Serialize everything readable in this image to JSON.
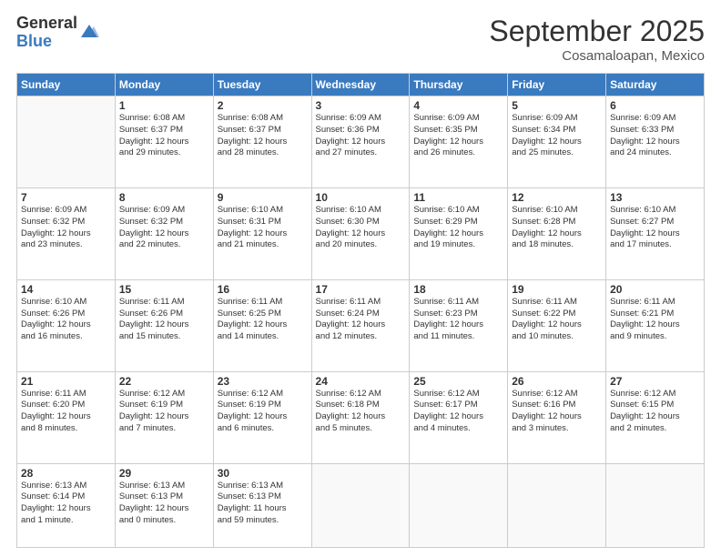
{
  "logo": {
    "general": "General",
    "blue": "Blue"
  },
  "title": "September 2025",
  "location": "Cosamaloapan, Mexico",
  "weekdays": [
    "Sunday",
    "Monday",
    "Tuesday",
    "Wednesday",
    "Thursday",
    "Friday",
    "Saturday"
  ],
  "weeks": [
    [
      {
        "day": "",
        "info": ""
      },
      {
        "day": "1",
        "info": "Sunrise: 6:08 AM\nSunset: 6:37 PM\nDaylight: 12 hours\nand 29 minutes."
      },
      {
        "day": "2",
        "info": "Sunrise: 6:08 AM\nSunset: 6:37 PM\nDaylight: 12 hours\nand 28 minutes."
      },
      {
        "day": "3",
        "info": "Sunrise: 6:09 AM\nSunset: 6:36 PM\nDaylight: 12 hours\nand 27 minutes."
      },
      {
        "day": "4",
        "info": "Sunrise: 6:09 AM\nSunset: 6:35 PM\nDaylight: 12 hours\nand 26 minutes."
      },
      {
        "day": "5",
        "info": "Sunrise: 6:09 AM\nSunset: 6:34 PM\nDaylight: 12 hours\nand 25 minutes."
      },
      {
        "day": "6",
        "info": "Sunrise: 6:09 AM\nSunset: 6:33 PM\nDaylight: 12 hours\nand 24 minutes."
      }
    ],
    [
      {
        "day": "7",
        "info": "Sunrise: 6:09 AM\nSunset: 6:32 PM\nDaylight: 12 hours\nand 23 minutes."
      },
      {
        "day": "8",
        "info": "Sunrise: 6:09 AM\nSunset: 6:32 PM\nDaylight: 12 hours\nand 22 minutes."
      },
      {
        "day": "9",
        "info": "Sunrise: 6:10 AM\nSunset: 6:31 PM\nDaylight: 12 hours\nand 21 minutes."
      },
      {
        "day": "10",
        "info": "Sunrise: 6:10 AM\nSunset: 6:30 PM\nDaylight: 12 hours\nand 20 minutes."
      },
      {
        "day": "11",
        "info": "Sunrise: 6:10 AM\nSunset: 6:29 PM\nDaylight: 12 hours\nand 19 minutes."
      },
      {
        "day": "12",
        "info": "Sunrise: 6:10 AM\nSunset: 6:28 PM\nDaylight: 12 hours\nand 18 minutes."
      },
      {
        "day": "13",
        "info": "Sunrise: 6:10 AM\nSunset: 6:27 PM\nDaylight: 12 hours\nand 17 minutes."
      }
    ],
    [
      {
        "day": "14",
        "info": "Sunrise: 6:10 AM\nSunset: 6:26 PM\nDaylight: 12 hours\nand 16 minutes."
      },
      {
        "day": "15",
        "info": "Sunrise: 6:11 AM\nSunset: 6:26 PM\nDaylight: 12 hours\nand 15 minutes."
      },
      {
        "day": "16",
        "info": "Sunrise: 6:11 AM\nSunset: 6:25 PM\nDaylight: 12 hours\nand 14 minutes."
      },
      {
        "day": "17",
        "info": "Sunrise: 6:11 AM\nSunset: 6:24 PM\nDaylight: 12 hours\nand 12 minutes."
      },
      {
        "day": "18",
        "info": "Sunrise: 6:11 AM\nSunset: 6:23 PM\nDaylight: 12 hours\nand 11 minutes."
      },
      {
        "day": "19",
        "info": "Sunrise: 6:11 AM\nSunset: 6:22 PM\nDaylight: 12 hours\nand 10 minutes."
      },
      {
        "day": "20",
        "info": "Sunrise: 6:11 AM\nSunset: 6:21 PM\nDaylight: 12 hours\nand 9 minutes."
      }
    ],
    [
      {
        "day": "21",
        "info": "Sunrise: 6:11 AM\nSunset: 6:20 PM\nDaylight: 12 hours\nand 8 minutes."
      },
      {
        "day": "22",
        "info": "Sunrise: 6:12 AM\nSunset: 6:19 PM\nDaylight: 12 hours\nand 7 minutes."
      },
      {
        "day": "23",
        "info": "Sunrise: 6:12 AM\nSunset: 6:19 PM\nDaylight: 12 hours\nand 6 minutes."
      },
      {
        "day": "24",
        "info": "Sunrise: 6:12 AM\nSunset: 6:18 PM\nDaylight: 12 hours\nand 5 minutes."
      },
      {
        "day": "25",
        "info": "Sunrise: 6:12 AM\nSunset: 6:17 PM\nDaylight: 12 hours\nand 4 minutes."
      },
      {
        "day": "26",
        "info": "Sunrise: 6:12 AM\nSunset: 6:16 PM\nDaylight: 12 hours\nand 3 minutes."
      },
      {
        "day": "27",
        "info": "Sunrise: 6:12 AM\nSunset: 6:15 PM\nDaylight: 12 hours\nand 2 minutes."
      }
    ],
    [
      {
        "day": "28",
        "info": "Sunrise: 6:13 AM\nSunset: 6:14 PM\nDaylight: 12 hours\nand 1 minute."
      },
      {
        "day": "29",
        "info": "Sunrise: 6:13 AM\nSunset: 6:13 PM\nDaylight: 12 hours\nand 0 minutes."
      },
      {
        "day": "30",
        "info": "Sunrise: 6:13 AM\nSunset: 6:13 PM\nDaylight: 11 hours\nand 59 minutes."
      },
      {
        "day": "",
        "info": ""
      },
      {
        "day": "",
        "info": ""
      },
      {
        "day": "",
        "info": ""
      },
      {
        "day": "",
        "info": ""
      }
    ]
  ]
}
